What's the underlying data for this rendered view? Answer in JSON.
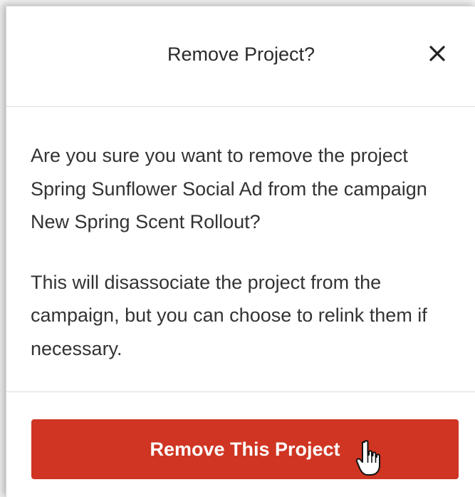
{
  "dialog": {
    "title": "Remove Project?",
    "close_icon": "close-icon",
    "body": {
      "paragraph_1": "Are you sure you want to remove the project Spring Sunflower Social Ad from the campaign New Spring Scent Rollout?",
      "paragraph_2": "This will disassociate the project from the campaign, but you can choose to relink them if necessary."
    },
    "primary_action": {
      "label": "Remove This Project"
    }
  },
  "colors": {
    "danger_button": "#cf3522",
    "title_text": "#2b2b2b",
    "body_text": "#333333"
  },
  "cursor_icon": "hand-pointer-icon"
}
